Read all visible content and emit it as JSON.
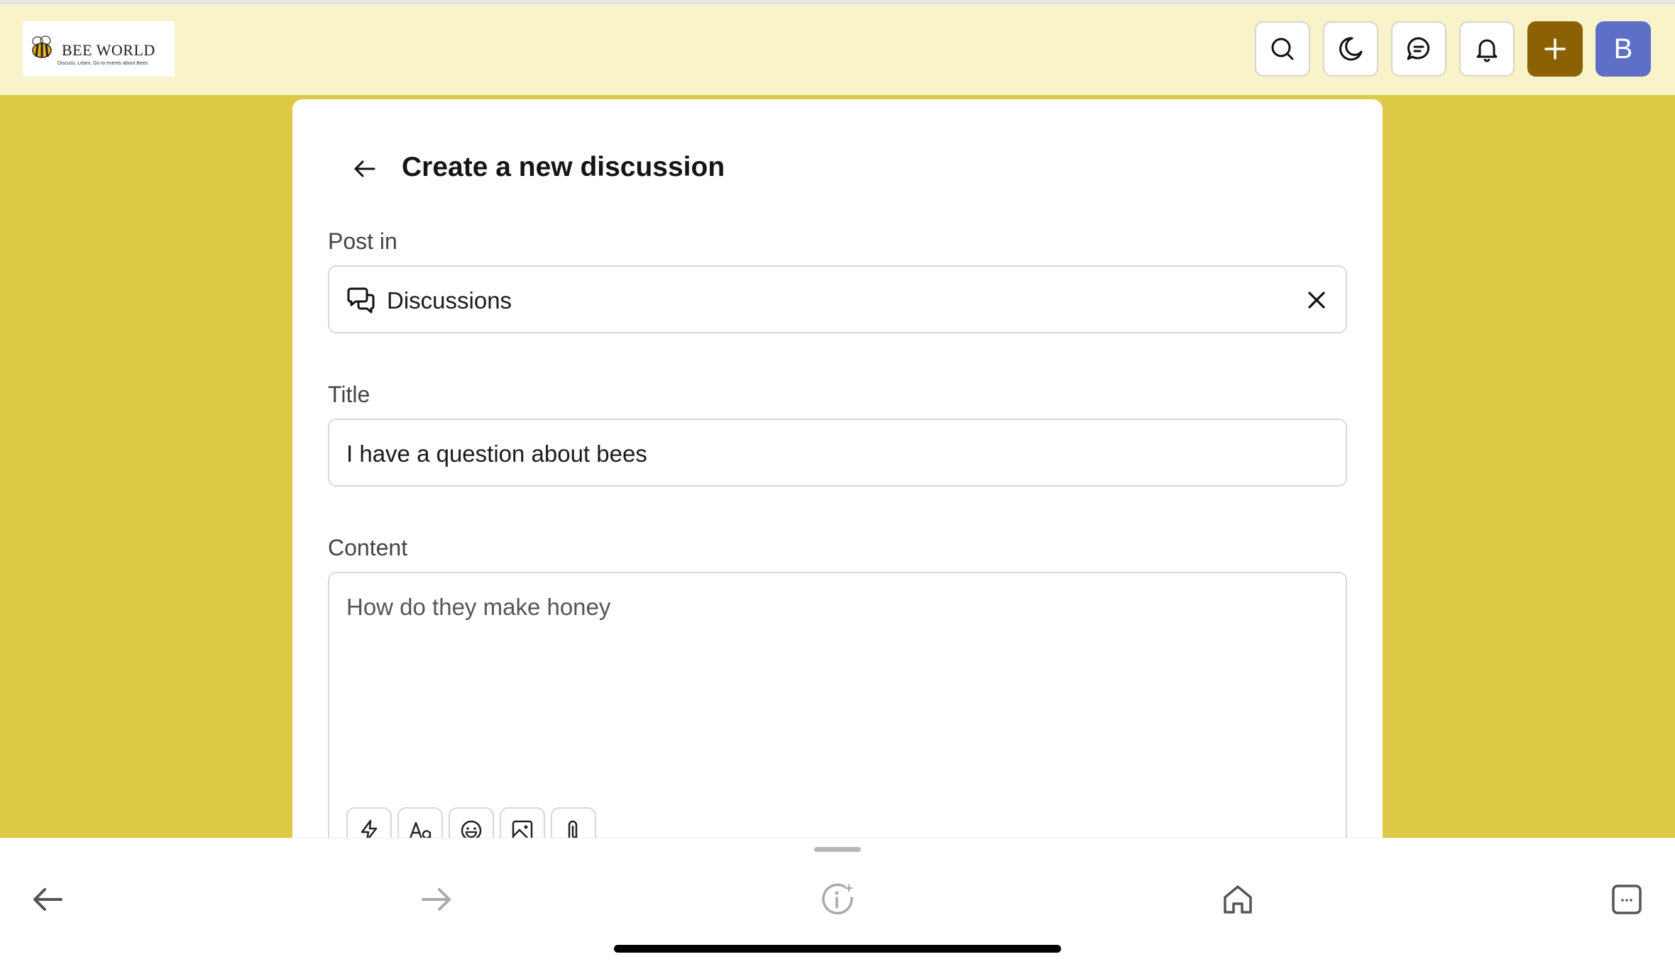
{
  "brand": {
    "name": "BEE WORLD",
    "tagline": "Discuss, Learn, Go to events about Bees."
  },
  "header": {
    "icons": [
      "search-icon",
      "moon-icon",
      "chat-icon",
      "bell-icon",
      "plus-icon"
    ],
    "avatar_initial": "B",
    "colors": {
      "header_bg": "#f9f3c9",
      "create_button": "#8c6104",
      "avatar": "#5d6fc7"
    }
  },
  "form": {
    "title": "Create a new discussion",
    "post_in": {
      "label": "Post in",
      "value": "Discussions"
    },
    "title_field": {
      "label": "Title",
      "value": "I have a question about bees"
    },
    "content_field": {
      "label": "Content",
      "value": "How do they make honey"
    },
    "toolbar": [
      "lightning-icon",
      "text-format-icon",
      "emoji-icon",
      "image-icon",
      "attach-icon"
    ]
  },
  "browser": {
    "nav": [
      "back-icon",
      "forward-icon",
      "info-icon",
      "home-icon",
      "tabs-icon"
    ]
  },
  "page_bg": "#dec947"
}
